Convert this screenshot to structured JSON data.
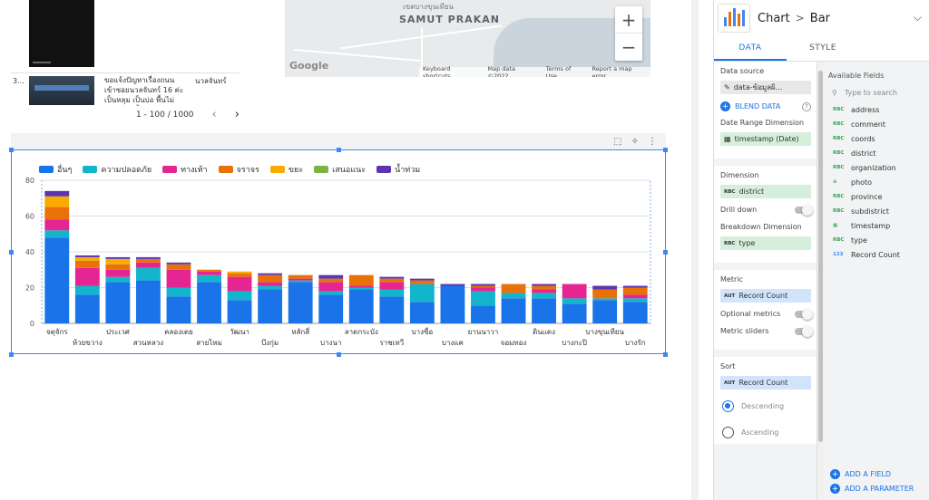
{
  "table": {
    "row_number": "3...",
    "comment": "ขอแจ้งปัญหาเรื่องถนน เข้าซอยนวลจันทร์ 16 ค่ะ เป็นหลุม เป็นบ่อ พื้นไม่ เสมอกันมีน้ำขังตลอด",
    "organization": "นวลจันทร์",
    "pagination": "1 - 100 / 1000",
    "prev_icon": "chevron-left-icon",
    "next_icon": "chevron-right-icon"
  },
  "map": {
    "region_label": "SAMUT PRAKAN",
    "top_label": "เขตบางขุนเทียน",
    "google_logo": "Google",
    "zoom_in": "+",
    "zoom_out": "−",
    "attribution": [
      "Keyboard shortcuts",
      "Map data ©2022",
      "Terms of Use",
      "Report a map error"
    ]
  },
  "chart_toolbar": {
    "icons": [
      "select-icon",
      "explore-icon",
      "more-vert-icon"
    ]
  },
  "chart_data": {
    "type": "bar",
    "stacked": true,
    "categories": [
      "จตุจักร",
      "ห้วยขวาง",
      "ประเวศ",
      "สวนหลวง",
      "คลองเตย",
      "สายไหม",
      "วัฒนา",
      "บึงกุ่ม",
      "หลักสี่",
      "บางนา",
      "ลาดกระบัง",
      "ราชเทวี",
      "บางซื่อ",
      "บางแค",
      "ยานนาวา",
      "จอมทอง",
      "ดินแดง",
      "บางกะปิ",
      "บางขุนเทียน",
      "บางรัก"
    ],
    "series": [
      {
        "name": "อื่นๆ",
        "color": "#1a73e8",
        "values": [
          48,
          16,
          23,
          24,
          15,
          23,
          13,
          19,
          23,
          16,
          19,
          15,
          12,
          21,
          10,
          14,
          14,
          11,
          13,
          12
        ]
      },
      {
        "name": "ความปลอดภัย",
        "color": "#12b5cb",
        "values": [
          4,
          5,
          3,
          7,
          5,
          4,
          5,
          2,
          1,
          2,
          1,
          4,
          10,
          0,
          8,
          3,
          3,
          3,
          1,
          2
        ]
      },
      {
        "name": "ทางเท้า",
        "color": "#e52592",
        "values": [
          6,
          10,
          4,
          3,
          10,
          2,
          8,
          2,
          1,
          5,
          1,
          4,
          0,
          0,
          2,
          0,
          2,
          8,
          0,
          2
        ]
      },
      {
        "name": "จราจร",
        "color": "#e8710a",
        "values": [
          7,
          4,
          3,
          2,
          3,
          1,
          2,
          4,
          2,
          2,
          6,
          2,
          2,
          0,
          1,
          5,
          2,
          0,
          5,
          4
        ]
      },
      {
        "name": "ขยะ",
        "color": "#f9ab00",
        "values": [
          6,
          2,
          3,
          0,
          0,
          0,
          1,
          0,
          0,
          0,
          0,
          0,
          0,
          0,
          0,
          0,
          0,
          0,
          0,
          0
        ]
      },
      {
        "name": "เสนอแนะ",
        "color": "#7cb342",
        "values": [
          0,
          0,
          0,
          0,
          0,
          0,
          0,
          0,
          0,
          0,
          0,
          0,
          0,
          0,
          0,
          0,
          0,
          0,
          0,
          0
        ]
      },
      {
        "name": "น้ำท่วม",
        "color": "#5e35b1",
        "values": [
          3,
          1,
          1,
          1,
          1,
          0,
          0,
          1,
          0,
          2,
          0,
          1,
          1,
          1,
          1,
          0,
          1,
          0,
          2,
          1
        ]
      }
    ],
    "ylim": [
      0,
      80
    ],
    "yticks": [
      0,
      20,
      40,
      60,
      80
    ],
    "grid": true,
    "legend": "top"
  },
  "panel": {
    "breadcrumb_chart": "Chart",
    "breadcrumb_sep": ">",
    "breadcrumb_type": "Bar",
    "tabs": [
      "DATA",
      "STYLE"
    ],
    "data_source_title": "Data source",
    "data_source_value": "data-ข้อมูลผิ...",
    "blend_label": "BLEND DATA",
    "help_glyph": "?",
    "date_range_title": "Date Range Dimension",
    "date_range_value": "timestamp (Date)",
    "dimension_title": "Dimension",
    "dimension_tag": "RBC",
    "dimension_value": "district",
    "drill_down": "Drill down",
    "breakdown_title": "Breakdown Dimension",
    "breakdown_tag": "RBC",
    "breakdown_value": "type",
    "metric_title": "Metric",
    "metric_tag": "AUT",
    "metric_value": "Record Count",
    "optional_metrics": "Optional metrics",
    "metric_sliders": "Metric sliders",
    "sort_title": "Sort",
    "sort_tag": "AUT",
    "sort_value": "Record Count",
    "descending": "Descending",
    "ascending": "Ascending",
    "available_fields_title": "Available Fields",
    "search_placeholder": "Type to search",
    "fields": [
      {
        "tag": "RBC",
        "name": "address"
      },
      {
        "tag": "RBC",
        "name": "comment"
      },
      {
        "tag": "RBC",
        "name": "coords"
      },
      {
        "tag": "RBC",
        "name": "district"
      },
      {
        "tag": "RBC",
        "name": "organization"
      },
      {
        "tag": "⊖",
        "name": "photo"
      },
      {
        "tag": "RBC",
        "name": "province"
      },
      {
        "tag": "RBC",
        "name": "subdistrict"
      },
      {
        "tag": "▦",
        "name": "timestamp"
      },
      {
        "tag": "RBC",
        "name": "type"
      },
      {
        "tag": "123",
        "name": "Record Count"
      }
    ],
    "add_field": "ADD A FIELD",
    "add_parameter": "ADD A PARAMETER"
  }
}
